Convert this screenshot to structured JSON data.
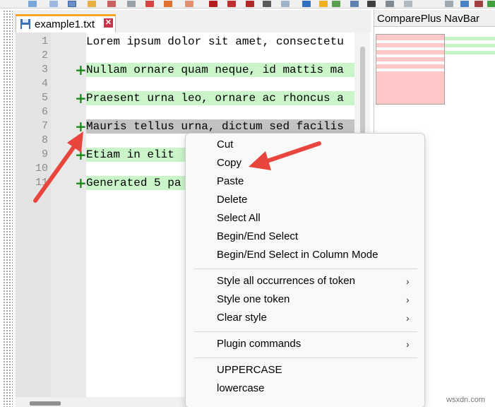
{
  "tab": {
    "label": "example1.txt",
    "close_symbol": "✕"
  },
  "navbar": {
    "title": "ComparePlus NavBar"
  },
  "editor": {
    "line_numbers": [
      "1",
      "2",
      "3",
      "4",
      "5",
      "6",
      "7",
      "8",
      "9",
      "10",
      "11"
    ],
    "lines": [
      {
        "text": "Lorem ipsum dolor sit amet, consectetu",
        "state": "normal"
      },
      {
        "text": "",
        "state": "normal"
      },
      {
        "text": "Nullam ornare quam neque, id mattis ma",
        "state": "added"
      },
      {
        "text": "",
        "state": "normal"
      },
      {
        "text": "Praesent urna leo, ornare ac rhoncus a",
        "state": "added"
      },
      {
        "text": "",
        "state": "normal"
      },
      {
        "text": "Mauris tellus urna, dictum sed facilis",
        "state": "selected"
      },
      {
        "text": "",
        "state": "normal"
      },
      {
        "text": "Etiam in elit",
        "state": "added"
      },
      {
        "text": "",
        "state": "normal"
      },
      {
        "text": "Generated 5 pa",
        "state": "added"
      }
    ],
    "colors": {
      "added": "#c9f5c9",
      "selected": "#c3c3c3",
      "plus": "#1a8a1a"
    }
  },
  "context_menu": {
    "groups": [
      [
        "Cut",
        "Copy",
        "Paste",
        "Delete",
        "Select All",
        "Begin/End Select",
        "Begin/End Select in Column Mode"
      ],
      [
        "Style all occurrences of token",
        "Style one token",
        "Clear style"
      ],
      [
        "Plugin commands"
      ],
      [
        "UPPERCASE",
        "lowercase"
      ]
    ],
    "submenu_indicator": "›"
  },
  "watermark": "wsxdn.com",
  "annotation_color": "#e8453c"
}
